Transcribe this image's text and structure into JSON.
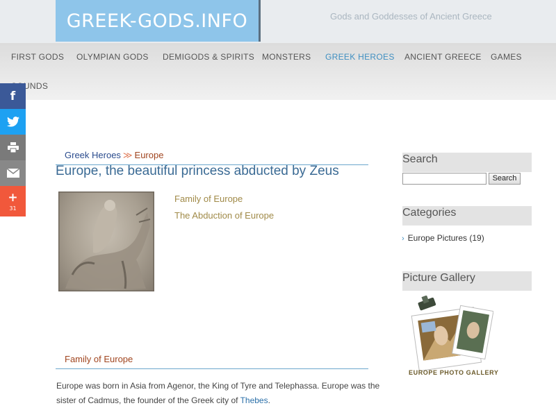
{
  "header": {
    "logo": "GREEK-GODS.INFO",
    "tagline": "Gods and Goddesses of Ancient Greece"
  },
  "nav": {
    "items": [
      {
        "label": "FIRST GODS"
      },
      {
        "label": "OLYMPIAN GODS"
      },
      {
        "label": "DEMIGODS & SPIRITS"
      },
      {
        "label": "MONSTERS"
      },
      {
        "label": "GREEK HEROES",
        "active": true
      },
      {
        "label": "ANCIENT GREECE"
      },
      {
        "label": "GAMES"
      },
      {
        "label": "SOUNDS"
      }
    ]
  },
  "share": {
    "more_count": "31",
    "icons": [
      "facebook-icon",
      "twitter-icon",
      "print-icon",
      "email-icon",
      "plus-icon"
    ]
  },
  "breadcrumb": {
    "parent": "Greek Heroes",
    "separator": "≫",
    "current": "Europe"
  },
  "article": {
    "title": "Europe, the beautiful princess abducted by Zeus",
    "toc": [
      "Family of Europe",
      "The Abduction of Europe"
    ],
    "section_heading": "Family of Europe",
    "para_part1": "Europe was born in Asia from Agenor, the King of Tyre and Telephassa. Europe was the sister of Cadmus, the founder of the Greek city of ",
    "para_link": "Thebes",
    "para_end": "."
  },
  "sidebar": {
    "search_title": "Search",
    "search_button": "Search",
    "search_value": "",
    "categories_title": "Categories",
    "category_item": "Europe Pictures (19)",
    "gallery_title": "Picture Gallery",
    "gallery_label": "EUROPE PHOTO GALLERY"
  },
  "colors": {
    "logo_bg": "#8ec5ea",
    "nav_active": "#3f8fc1",
    "title": "#3a6a94",
    "facebook": "#3b5998",
    "twitter": "#1da1f2",
    "plus": "#f1583b"
  }
}
